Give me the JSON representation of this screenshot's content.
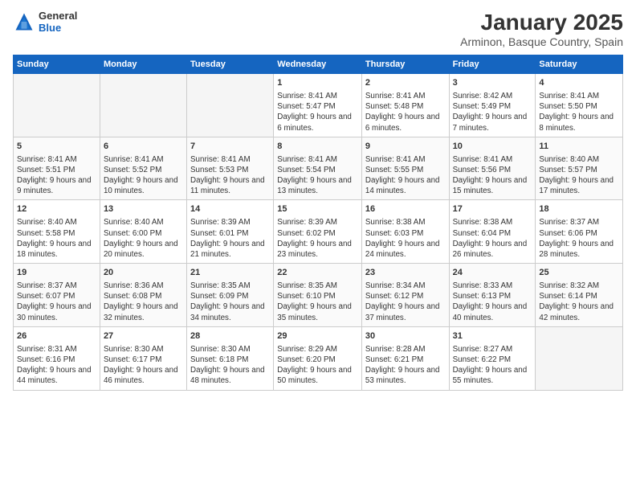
{
  "header": {
    "logo_general": "General",
    "logo_blue": "Blue",
    "month_title": "January 2025",
    "location": "Arminon, Basque Country, Spain"
  },
  "weekdays": [
    "Sunday",
    "Monday",
    "Tuesday",
    "Wednesday",
    "Thursday",
    "Friday",
    "Saturday"
  ],
  "weeks": [
    [
      {
        "day": "",
        "info": ""
      },
      {
        "day": "",
        "info": ""
      },
      {
        "day": "",
        "info": ""
      },
      {
        "day": "1",
        "info": "Sunrise: 8:41 AM\nSunset: 5:47 PM\nDaylight: 9 hours and 6 minutes."
      },
      {
        "day": "2",
        "info": "Sunrise: 8:41 AM\nSunset: 5:48 PM\nDaylight: 9 hours and 6 minutes."
      },
      {
        "day": "3",
        "info": "Sunrise: 8:42 AM\nSunset: 5:49 PM\nDaylight: 9 hours and 7 minutes."
      },
      {
        "day": "4",
        "info": "Sunrise: 8:41 AM\nSunset: 5:50 PM\nDaylight: 9 hours and 8 minutes."
      }
    ],
    [
      {
        "day": "5",
        "info": "Sunrise: 8:41 AM\nSunset: 5:51 PM\nDaylight: 9 hours and 9 minutes."
      },
      {
        "day": "6",
        "info": "Sunrise: 8:41 AM\nSunset: 5:52 PM\nDaylight: 9 hours and 10 minutes."
      },
      {
        "day": "7",
        "info": "Sunrise: 8:41 AM\nSunset: 5:53 PM\nDaylight: 9 hours and 11 minutes."
      },
      {
        "day": "8",
        "info": "Sunrise: 8:41 AM\nSunset: 5:54 PM\nDaylight: 9 hours and 13 minutes."
      },
      {
        "day": "9",
        "info": "Sunrise: 8:41 AM\nSunset: 5:55 PM\nDaylight: 9 hours and 14 minutes."
      },
      {
        "day": "10",
        "info": "Sunrise: 8:41 AM\nSunset: 5:56 PM\nDaylight: 9 hours and 15 minutes."
      },
      {
        "day": "11",
        "info": "Sunrise: 8:40 AM\nSunset: 5:57 PM\nDaylight: 9 hours and 17 minutes."
      }
    ],
    [
      {
        "day": "12",
        "info": "Sunrise: 8:40 AM\nSunset: 5:58 PM\nDaylight: 9 hours and 18 minutes."
      },
      {
        "day": "13",
        "info": "Sunrise: 8:40 AM\nSunset: 6:00 PM\nDaylight: 9 hours and 20 minutes."
      },
      {
        "day": "14",
        "info": "Sunrise: 8:39 AM\nSunset: 6:01 PM\nDaylight: 9 hours and 21 minutes."
      },
      {
        "day": "15",
        "info": "Sunrise: 8:39 AM\nSunset: 6:02 PM\nDaylight: 9 hours and 23 minutes."
      },
      {
        "day": "16",
        "info": "Sunrise: 8:38 AM\nSunset: 6:03 PM\nDaylight: 9 hours and 24 minutes."
      },
      {
        "day": "17",
        "info": "Sunrise: 8:38 AM\nSunset: 6:04 PM\nDaylight: 9 hours and 26 minutes."
      },
      {
        "day": "18",
        "info": "Sunrise: 8:37 AM\nSunset: 6:06 PM\nDaylight: 9 hours and 28 minutes."
      }
    ],
    [
      {
        "day": "19",
        "info": "Sunrise: 8:37 AM\nSunset: 6:07 PM\nDaylight: 9 hours and 30 minutes."
      },
      {
        "day": "20",
        "info": "Sunrise: 8:36 AM\nSunset: 6:08 PM\nDaylight: 9 hours and 32 minutes."
      },
      {
        "day": "21",
        "info": "Sunrise: 8:35 AM\nSunset: 6:09 PM\nDaylight: 9 hours and 34 minutes."
      },
      {
        "day": "22",
        "info": "Sunrise: 8:35 AM\nSunset: 6:10 PM\nDaylight: 9 hours and 35 minutes."
      },
      {
        "day": "23",
        "info": "Sunrise: 8:34 AM\nSunset: 6:12 PM\nDaylight: 9 hours and 37 minutes."
      },
      {
        "day": "24",
        "info": "Sunrise: 8:33 AM\nSunset: 6:13 PM\nDaylight: 9 hours and 40 minutes."
      },
      {
        "day": "25",
        "info": "Sunrise: 8:32 AM\nSunset: 6:14 PM\nDaylight: 9 hours and 42 minutes."
      }
    ],
    [
      {
        "day": "26",
        "info": "Sunrise: 8:31 AM\nSunset: 6:16 PM\nDaylight: 9 hours and 44 minutes."
      },
      {
        "day": "27",
        "info": "Sunrise: 8:30 AM\nSunset: 6:17 PM\nDaylight: 9 hours and 46 minutes."
      },
      {
        "day": "28",
        "info": "Sunrise: 8:30 AM\nSunset: 6:18 PM\nDaylight: 9 hours and 48 minutes."
      },
      {
        "day": "29",
        "info": "Sunrise: 8:29 AM\nSunset: 6:20 PM\nDaylight: 9 hours and 50 minutes."
      },
      {
        "day": "30",
        "info": "Sunrise: 8:28 AM\nSunset: 6:21 PM\nDaylight: 9 hours and 53 minutes."
      },
      {
        "day": "31",
        "info": "Sunrise: 8:27 AM\nSunset: 6:22 PM\nDaylight: 9 hours and 55 minutes."
      },
      {
        "day": "",
        "info": ""
      }
    ]
  ]
}
